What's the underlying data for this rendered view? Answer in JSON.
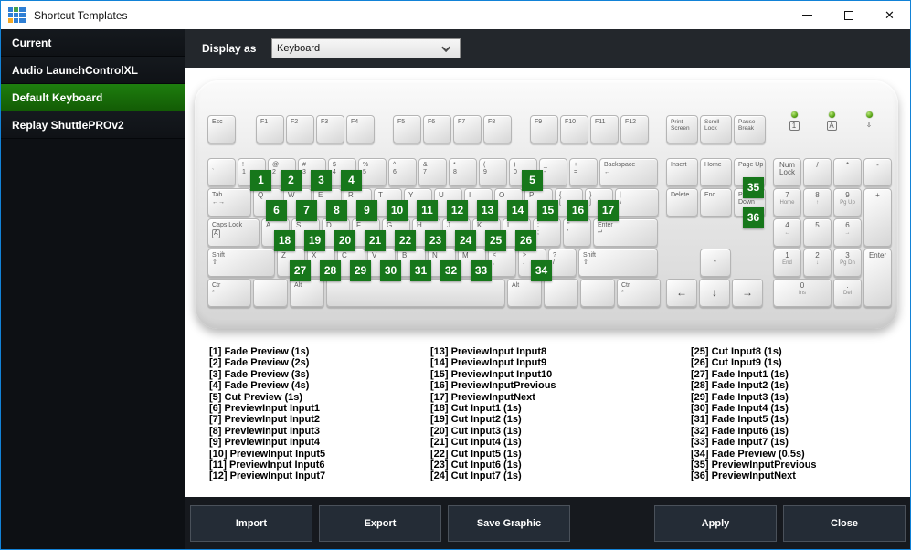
{
  "window": {
    "title": "Shortcut Templates",
    "controls": {
      "minimize": "minimize",
      "maximize": "maximize",
      "close": "close"
    },
    "border_color": "#1282d7"
  },
  "app_icon_colors": [
    "#2f7fd4",
    "#43a047",
    "#2f7fd4",
    "#2f7fd4",
    "#2f7fd4",
    "#2f7fd4",
    "#f6a821",
    "#2f7fd4",
    "#2f7fd4"
  ],
  "sidebar": {
    "items": [
      {
        "label": "Current",
        "selected": false
      },
      {
        "label": "Audio LaunchControlXL",
        "selected": false
      },
      {
        "label": "Default Keyboard",
        "selected": true
      },
      {
        "label": "Replay ShuttlePROv2",
        "selected": false
      }
    ]
  },
  "topbar": {
    "display_as_label": "Display as",
    "display_as_value": "Keyboard"
  },
  "keyboard": {
    "badge_color": "#17771b",
    "function_row": [
      {
        "t": "Esc",
        "w": 1
      },
      {
        "gap": 0.62
      },
      {
        "t": "F1",
        "w": 1
      },
      {
        "t": "F2",
        "w": 1
      },
      {
        "t": "F3",
        "w": 1
      },
      {
        "t": "F4",
        "w": 1
      },
      {
        "gap": 0.55
      },
      {
        "t": "F5",
        "w": 1
      },
      {
        "t": "F6",
        "w": 1
      },
      {
        "t": "F7",
        "w": 1
      },
      {
        "t": "F8",
        "w": 1
      },
      {
        "gap": 0.55
      },
      {
        "t": "F9",
        "w": 1
      },
      {
        "t": "F10",
        "w": 1
      },
      {
        "t": "F11",
        "w": 1
      },
      {
        "t": "F12",
        "w": 1
      }
    ],
    "main_rows": [
      [
        {
          "s": "~",
          "t": "`",
          "w": 1
        },
        {
          "s": "!",
          "t": "1",
          "w": 1,
          "badge": 1
        },
        {
          "s": "@",
          "t": "2",
          "w": 1,
          "badge": 2
        },
        {
          "s": "#",
          "t": "3",
          "w": 1,
          "badge": 3
        },
        {
          "s": "$",
          "t": "4",
          "w": 1,
          "badge": 4
        },
        {
          "s": "%",
          "t": "5",
          "w": 1
        },
        {
          "s": "^",
          "t": "6",
          "w": 1
        },
        {
          "s": "&",
          "t": "7",
          "w": 1
        },
        {
          "s": "*",
          "t": "8",
          "w": 1
        },
        {
          "s": "(",
          "t": "9",
          "w": 1
        },
        {
          "s": ")",
          "t": "0",
          "w": 1,
          "badge": 5
        },
        {
          "s": "_",
          "t": "-",
          "w": 1
        },
        {
          "s": "+",
          "t": "=",
          "w": 1
        },
        {
          "t": "Backspace",
          "sub": "←",
          "w": 2
        }
      ],
      [
        {
          "t": "Tab",
          "sub": "←→",
          "w": 1.5
        },
        {
          "t": "Q",
          "w": 1,
          "badge": 6
        },
        {
          "t": "W",
          "w": 1,
          "badge": 7
        },
        {
          "t": "E",
          "w": 1,
          "badge": 8
        },
        {
          "t": "R",
          "w": 1,
          "badge": 9
        },
        {
          "t": "T",
          "w": 1,
          "badge": 10
        },
        {
          "t": "Y",
          "w": 1,
          "badge": 11
        },
        {
          "t": "U",
          "w": 1,
          "badge": 12
        },
        {
          "t": "I",
          "w": 1,
          "badge": 13
        },
        {
          "t": "O",
          "w": 1,
          "badge": 14
        },
        {
          "t": "P",
          "w": 1,
          "badge": 15
        },
        {
          "s": "{",
          "t": "[",
          "w": 1,
          "badge": 16
        },
        {
          "s": "}",
          "t": "]",
          "w": 1,
          "badge": 17
        },
        {
          "s": "|",
          "t": "\\",
          "w": 1.5
        }
      ],
      [
        {
          "t": "Caps Lock",
          "sub": "A",
          "boxsub": true,
          "w": 1.8
        },
        {
          "t": "A",
          "w": 1,
          "badge": 18
        },
        {
          "t": "S",
          "w": 1,
          "badge": 19
        },
        {
          "t": "D",
          "w": 1,
          "badge": 20
        },
        {
          "t": "F",
          "w": 1,
          "badge": 21
        },
        {
          "t": "G",
          "w": 1,
          "badge": 22
        },
        {
          "t": "H",
          "w": 1,
          "badge": 23
        },
        {
          "t": "J",
          "w": 1,
          "badge": 24
        },
        {
          "t": "K",
          "w": 1,
          "badge": 25
        },
        {
          "t": "L",
          "w": 1,
          "badge": 26
        },
        {
          "s": ":",
          "t": ";",
          "w": 1
        },
        {
          "s": "\"",
          "t": "'",
          "w": 1
        },
        {
          "t": "Enter",
          "sub": "↵",
          "w": 2.2
        }
      ],
      [
        {
          "t": "Shift",
          "sub": "⇧",
          "w": 2.3
        },
        {
          "t": "Z",
          "w": 1,
          "badge": 27
        },
        {
          "t": "X",
          "w": 1,
          "badge": 28
        },
        {
          "t": "C",
          "w": 1,
          "badge": 29
        },
        {
          "t": "V",
          "w": 1,
          "badge": 30
        },
        {
          "t": "B",
          "w": 1,
          "badge": 31
        },
        {
          "t": "N",
          "w": 1,
          "badge": 32
        },
        {
          "t": "M",
          "w": 1,
          "badge": 33
        },
        {
          "s": "<",
          "t": ",",
          "w": 1
        },
        {
          "s": ">",
          "t": ".",
          "w": 1,
          "badge": 34
        },
        {
          "s": "?",
          "t": "/",
          "w": 1
        },
        {
          "t": "Shift",
          "sub": "⇧",
          "w": 2.7
        }
      ],
      [
        {
          "t": "Ctr",
          "sub": "*",
          "w": 1.5
        },
        {
          "t": "",
          "w": 1.2
        },
        {
          "t": "Alt",
          "w": 1.2
        },
        {
          "t": "",
          "w": 6.0,
          "space": true
        },
        {
          "t": "Alt",
          "w": 1.2
        },
        {
          "t": "",
          "w": 1.2
        },
        {
          "t": "",
          "w": 1.2
        },
        {
          "t": "Ctr",
          "sub": "*",
          "w": 1.5
        }
      ]
    ],
    "sys_keys": [
      {
        "t": "Print Screen"
      },
      {
        "t": "Scroll Lock"
      },
      {
        "t": "Pause Break"
      }
    ],
    "nav_rows": [
      [
        {
          "t": "Insert"
        },
        {
          "t": "Home"
        },
        {
          "t": "Page Up",
          "badge": 35
        }
      ],
      [
        {
          "t": "Delete"
        },
        {
          "t": "End"
        },
        {
          "t": "Page Down",
          "badge": 36
        }
      ]
    ],
    "arrows": {
      "up": "↑",
      "left": "←",
      "down": "↓",
      "right": "→"
    },
    "leds": [
      {
        "glyph": "1",
        "boxed": true
      },
      {
        "glyph": "A",
        "boxed": true
      },
      {
        "glyph": "⇩",
        "boxed": false
      }
    ],
    "numpad": [
      {
        "t": "Num Lock"
      },
      {
        "t": "/"
      },
      {
        "t": "*"
      },
      {
        "t": "-"
      },
      {
        "t": "7",
        "sub": "Home"
      },
      {
        "t": "8",
        "sub": "↑"
      },
      {
        "t": "9",
        "sub": "Pg Up"
      },
      {
        "t": "+",
        "rows": 2
      },
      {
        "t": "4",
        "sub": "←"
      },
      {
        "t": "5"
      },
      {
        "t": "6",
        "sub": "→"
      },
      {
        "t": "1",
        "sub": "End"
      },
      {
        "t": "2",
        "sub": "↓"
      },
      {
        "t": "3",
        "sub": "Pg Dn"
      },
      {
        "t": "Enter",
        "rows": 2
      },
      {
        "t": "0",
        "sub": "Ins",
        "cols": 2
      },
      {
        "t": ".",
        "sub": "Del"
      }
    ]
  },
  "shortcuts": {
    "columns": [
      [
        "[1] Fade Preview (1s)",
        "[2] Fade Preview (2s)",
        "[3] Fade Preview (3s)",
        "[4] Fade Preview (4s)",
        "[5] Cut Preview (1s)",
        "[6] PreviewInput Input1",
        "[7] PreviewInput Input2",
        "[8] PreviewInput Input3",
        "[9] PreviewInput Input4",
        "[10] PreviewInput Input5",
        "[11] PreviewInput Input6",
        "[12] PreviewInput Input7"
      ],
      [
        "[13] PreviewInput Input8",
        "[14] PreviewInput Input9",
        "[15] PreviewInput Input10",
        "[16] PreviewInputPrevious",
        "[17] PreviewInputNext",
        "[18] Cut Input1 (1s)",
        "[19] Cut Input2 (1s)",
        "[20] Cut Input3 (1s)",
        "[21] Cut Input4 (1s)",
        "[22] Cut Input5 (1s)",
        "[23] Cut Input6 (1s)",
        "[24] Cut Input7 (1s)"
      ],
      [
        "[25] Cut Input8 (1s)",
        "[26] Cut Input9 (1s)",
        "[27] Fade Input1 (1s)",
        "[28] Fade Input2 (1s)",
        "[29] Fade Input3 (1s)",
        "[30] Fade Input4 (1s)",
        "[31] Fade Input5 (1s)",
        "[32] Fade Input6 (1s)",
        "[33] Fade Input7 (1s)",
        "[34] Fade Preview (0.5s)",
        "[35] PreviewInputPrevious",
        "[36] PreviewInputNext"
      ]
    ]
  },
  "footer": {
    "buttons_left": [
      "Import",
      "Export",
      "Save Graphic"
    ],
    "buttons_right": [
      "Apply",
      "Close"
    ]
  }
}
